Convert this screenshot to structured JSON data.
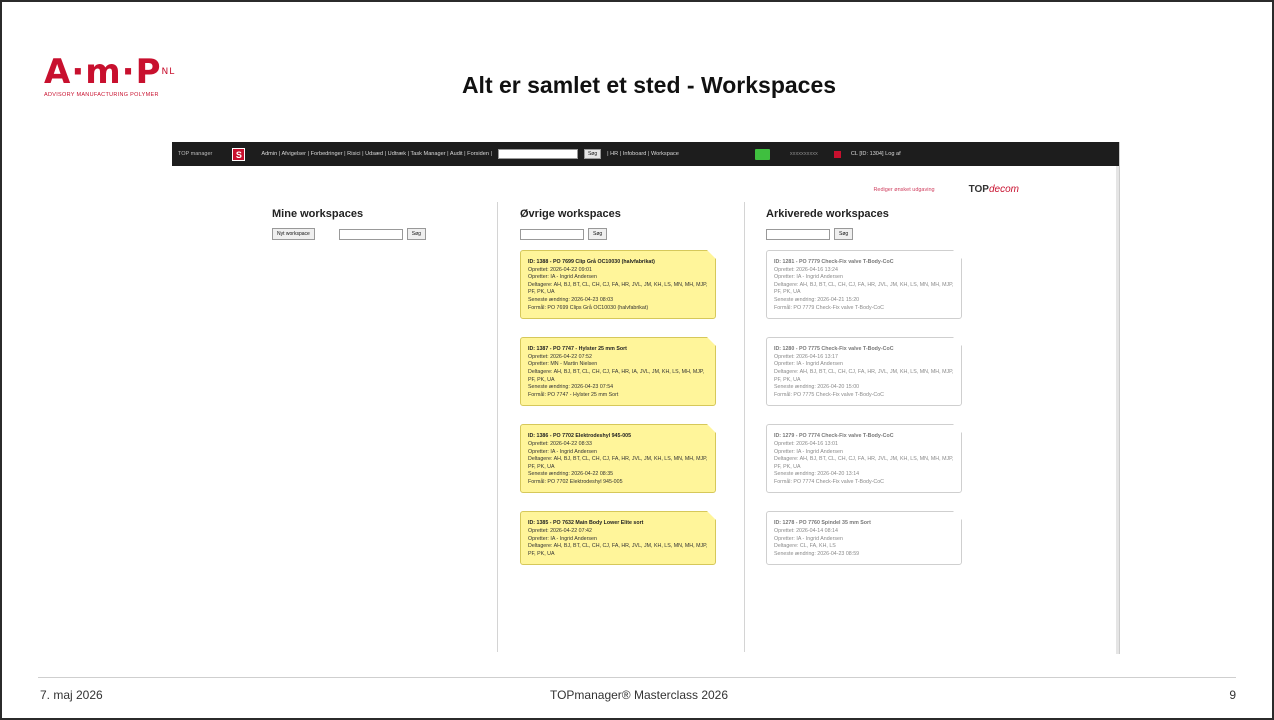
{
  "slide": {
    "title": "Alt er samlet et sted - Workspaces",
    "logo": {
      "mark": "A·m·P",
      "sup": "NL",
      "sub": "ADVISORY MANUFACTURING POLYMER"
    },
    "footer": {
      "date": "7. maj 2026",
      "center": "TOPmanager® Masterclass 2026",
      "page": "9"
    }
  },
  "app": {
    "nav": {
      "brand": "TOP manager",
      "logo_letter": "S",
      "menu": "Admin | Afvigelser | Forbedringer | Risici | Udsæd | Udtræk | Task Manager | Audit | Forsiden |",
      "search_button": "Søg",
      "menu2": "| HR | Infoboard | Workspace",
      "user": "xxxxxxxxxx",
      "right": "CL [ID: 1304] Log af"
    },
    "header": {
      "request_link": "Rediger ønsket udgaving",
      "logo_top": "TOP",
      "logo_rest": "decom"
    },
    "columns": {
      "mine": {
        "title": "Mine workspaces",
        "new_button": "Nyt workspace",
        "search_button": "Søg"
      },
      "other": {
        "title": "Øvrige workspaces",
        "search_button": "Søg"
      },
      "archived": {
        "title": "Arkiverede workspaces",
        "search_button": "Søg"
      }
    },
    "other_cards": [
      {
        "title": "ID: 1388 - PO 7699 Clip Grå OC10030 (halvfabrikat)",
        "lines": [
          "Oprettet: 2026-04-22 09:01",
          "Opretter: IA - Ingrid Andersen",
          "Deltagere: AH, BJ, BT, CL, CH, CJ, FA, HR, JVL, JM, KH, LS, MN, MH, MJP, PF, PK, UA",
          "Seneste ændring: 2026-04-23 08:03",
          "Formål: PO 7699 Clips Grå OC10030 (halvfabrikat)"
        ]
      },
      {
        "title": "ID: 1387 - PO 7747 - Hylster 25 mm Sort",
        "lines": [
          "Oprettet: 2026-04-22 07:52",
          "Opretter: MN - Martin Nielsen",
          "Deltagere: AH, BJ, BT, CL, CH, CJ, FA, HR, IA, JVL, JM, KH, LS, MH, MJP, PF, PK, UA",
          "Seneste ændring: 2026-04-23 07:54",
          "Formål: PO 7747 - Hylster 25 mm Sort"
        ]
      },
      {
        "title": "ID: 1386 - PO 7702 Elektrodeshyl 945-005",
        "lines": [
          "Oprettet: 2026-04-22 08:33",
          "Opretter: IA - Ingrid Andersen",
          "Deltagere: AH, BJ, BT, CL, CH, CJ, FA, HR, JVL, JM, KH, LS, MN, MH, MJP, PF, PK, UA",
          "Seneste ændring: 2026-04-22 08:35",
          "Formål: PO 7702 Elektrodeshyl 945-005"
        ]
      },
      {
        "title": "ID: 1385 - PO 7632 Main Body Lower Elite sort",
        "lines": [
          "Oprettet: 2026-04-22 07:42",
          "Opretter: IA - Ingrid Andersen",
          "Deltagere: AH, BJ, BT, CL, CH, CJ, FA, HR, JVL, JM, KH, LS, MN, MH, MJP, PF, PK, UA"
        ]
      }
    ],
    "archived_cards": [
      {
        "title": "ID: 1281 - PO 7779 Check-Fix valve T-Body-CoC",
        "lines": [
          "Oprettet: 2026-04-16 13:24",
          "Opretter: IA - Ingrid Andersen",
          "Deltagere: AH, BJ, BT, CL, CH, CJ, FA, HR, JVL, JM, KH, LS, MN, MH, MJP, PF, PK, UA",
          "Seneste ændring: 2026-04-21 15:20",
          "Formål: PO 7779 Check-Fix valve T-Body-CoC"
        ]
      },
      {
        "title": "ID: 1280 - PO 7775 Check-Fix valve T-Body-CoC",
        "lines": [
          "Oprettet: 2026-04-16 13:17",
          "Opretter: IA - Ingrid Andersen",
          "Deltagere: AH, BJ, BT, CL, CH, CJ, FA, HR, JVL, JM, KH, LS, MN, MH, MJP, PF, PK, UA",
          "Seneste ændring: 2026-04-20 15:00",
          "Formål: PO 7775 Check-Fix valve T-Body-CoC"
        ]
      },
      {
        "title": "ID: 1279 - PO 7774 Check-Fix valve T-Body-CoC",
        "lines": [
          "Oprettet: 2026-04-16 13:01",
          "Opretter: IA - Ingrid Andersen",
          "Deltagere: AH, BJ, BT, CL, CH, CJ, FA, HR, JVL, JM, KH, LS, MN, MH, MJP, PF, PK, UA",
          "Seneste ændring: 2026-04-20 13:14",
          "Formål: PO 7774 Check-Fix valve T-Body-CoC"
        ]
      },
      {
        "title": "ID: 1278 - PO 7760 Spindel 35 mm Sort",
        "lines": [
          "Oprettet: 2026-04-14 08:14",
          "Opretter: IA - Ingrid Andersen",
          "Deltagere: CL, FA, KH, LS",
          "Seneste ændring: 2026-04-23 08:59"
        ]
      }
    ]
  }
}
